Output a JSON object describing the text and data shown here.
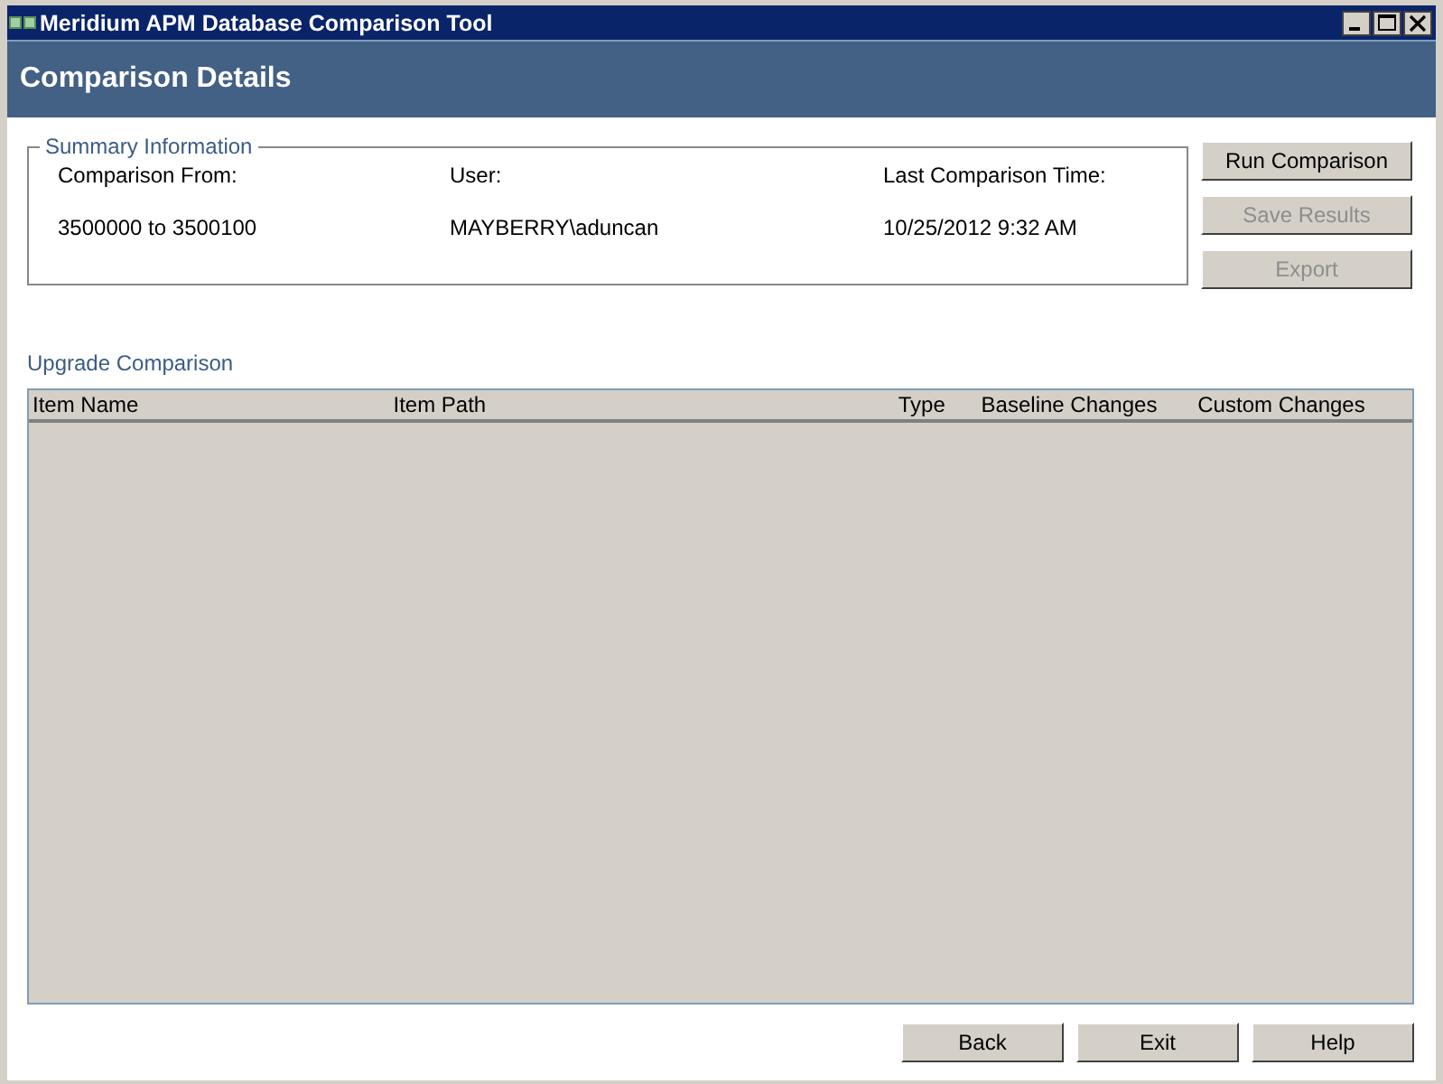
{
  "window": {
    "title": "Meridium APM Database Comparison Tool"
  },
  "header": {
    "title": "Comparison Details"
  },
  "summary": {
    "legend": "Summary Information",
    "fields": [
      {
        "label": "Comparison From:",
        "value": "3500000 to 3500100"
      },
      {
        "label": "User:",
        "value": "MAYBERRY\\aduncan"
      },
      {
        "label": "Last Comparison Time:",
        "value": "10/25/2012 9:32 AM"
      }
    ]
  },
  "side_buttons": [
    {
      "label": "Run Comparison",
      "disabled": false
    },
    {
      "label": "Save Results",
      "disabled": true
    },
    {
      "label": "Export",
      "disabled": true
    }
  ],
  "grid": {
    "title": "Upgrade Comparison",
    "columns": [
      "Item Name",
      "Item Path",
      "Type",
      "Baseline Changes",
      "Custom Changes"
    ]
  },
  "footer_buttons": [
    "Back",
    "Exit",
    "Help"
  ]
}
